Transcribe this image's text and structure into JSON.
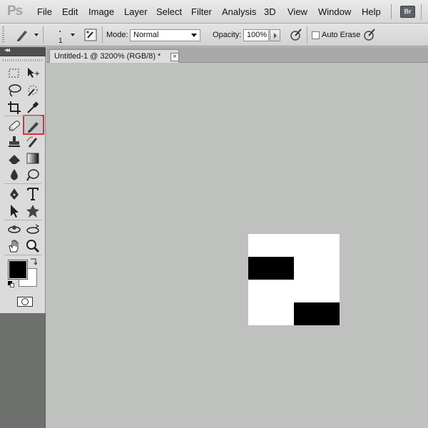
{
  "app": {
    "logo": "Ps"
  },
  "menu": {
    "items": [
      "File",
      "Edit",
      "Image",
      "Layer",
      "Select",
      "Filter",
      "Analysis",
      "3D",
      "View",
      "Window",
      "Help"
    ],
    "bridge_badge": "Br"
  },
  "options": {
    "brush_size": "1",
    "mode_label": "Mode:",
    "mode_value": "Normal",
    "opacity_label": "Opacity:",
    "opacity_value": "100%",
    "auto_erase_label": "Auto Erase",
    "auto_erase_checked": false
  },
  "document": {
    "tab_title": "Untitled-1 @ 3200% (RGB/8) *",
    "close_glyph": "×"
  },
  "colors": {
    "accent_selection": "#e22b35",
    "foreground": "#000000",
    "background": "#ffffff",
    "workspace": "#bfc1bf"
  },
  "tools": [
    "rectangular-marquee-icon",
    "move-icon",
    "lasso-icon",
    "quick-selection-icon",
    "crop-icon",
    "eyedropper-icon",
    "spot-healing-icon",
    "pencil-icon",
    "clone-stamp-icon",
    "history-brush-icon",
    "eraser-icon",
    "gradient-icon",
    "blur-icon",
    "dodge-icon",
    "pen-icon",
    "type-icon",
    "path-selection-icon",
    "custom-shape-icon",
    "3d-rotate-icon",
    "3d-orbit-icon",
    "hand-icon",
    "zoom-icon"
  ],
  "selected_tool": "pencil-icon"
}
